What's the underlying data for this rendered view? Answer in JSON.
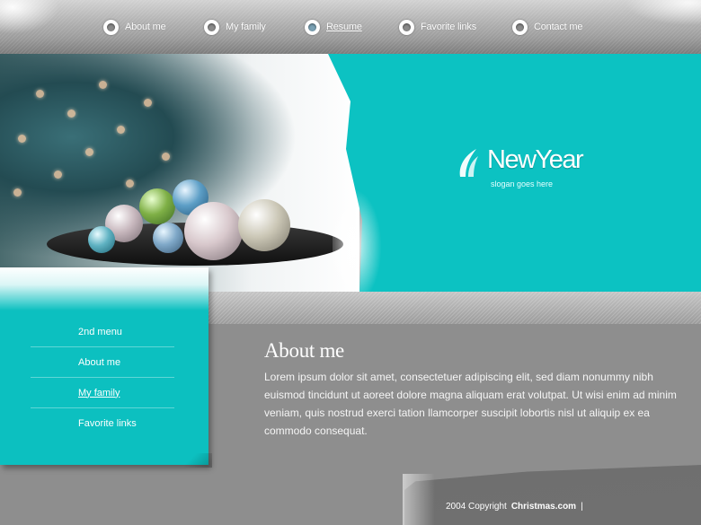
{
  "nav": {
    "items": [
      {
        "label": "About me"
      },
      {
        "label": "My family"
      },
      {
        "label": "Resume"
      },
      {
        "label": "Favorite links"
      },
      {
        "label": "Contact me"
      }
    ],
    "active": "Resume"
  },
  "brand": {
    "name": "NewYear",
    "slogan": "slogan goes here"
  },
  "sidebar": {
    "items": [
      {
        "label": "2nd menu"
      },
      {
        "label": "About me"
      },
      {
        "label": "My family"
      },
      {
        "label": "Favorite links"
      }
    ],
    "active": "My family"
  },
  "content": {
    "title": "About me",
    "body": "Lorem ipsum dolor sit amet, consectetuer adipiscing elit, sed diam nonummy nibh euismod tincidunt ut aoreet dolore magna aliquam erat volutpat. Ut wisi enim ad minim veniam, quis nostrud exerci tation llamcorper suscipit lobortis nisl ut aliquip ex ea commodo consequat."
  },
  "footer": {
    "copyright": "2004 Copyright",
    "site": "Christmas.com",
    "separator": "|"
  },
  "colors": {
    "accent": "#0cc2c2",
    "background": "#8e8e8e"
  }
}
